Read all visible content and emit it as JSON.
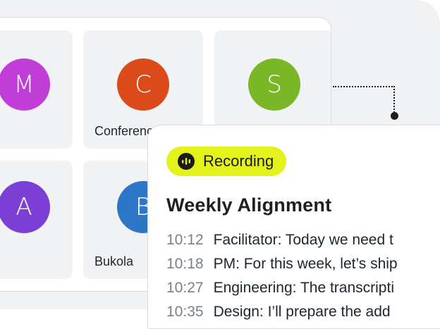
{
  "tiles": [
    {
      "initial": "M",
      "name": "",
      "color": "#c13dd8"
    },
    {
      "initial": "C",
      "name": "Conference",
      "color": "#db4a1a"
    },
    {
      "initial": "S",
      "name": "",
      "color": "#7ab727"
    },
    {
      "initial": "A",
      "name": "",
      "color": "#7c3fd6"
    },
    {
      "initial": "B",
      "name": "Bukola",
      "color": "#2d77c6"
    }
  ],
  "card": {
    "badge_label": "Recording",
    "title": "Weekly Alignment",
    "transcript": [
      {
        "time": "10:12",
        "text": "Facilitator: Today we need t"
      },
      {
        "time": "10:18",
        "text": "PM: For this week, let’s ship"
      },
      {
        "time": "10:27",
        "text": "Engineering: The transcripti"
      },
      {
        "time": "10:35",
        "text": "Design: I’ll prepare the add"
      }
    ]
  },
  "colors": {
    "badge": "#e2f21a",
    "panel_border": "#d7dbe3",
    "backdrop": "#f1f2f4"
  },
  "icons": {
    "recording": "audio-waveform-icon"
  }
}
